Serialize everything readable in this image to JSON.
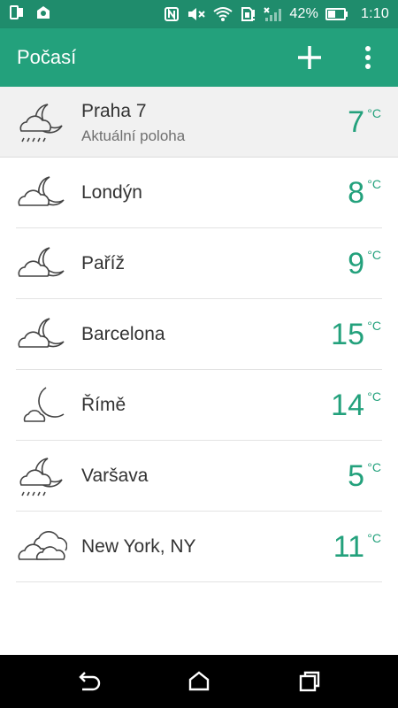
{
  "status_bar": {
    "battery": "42%",
    "time": "1:10"
  },
  "app_bar": {
    "title": "Počasí",
    "add_icon": "plus-icon",
    "menu_icon": "more-vertical-icon"
  },
  "colors": {
    "primary": "#23a17c",
    "status_bar": "#1f8c6c",
    "current_row_bg": "#f1f1f1"
  },
  "locations": [
    {
      "city": "Praha 7",
      "subtitle": "Aktuální poloha",
      "temp": "7",
      "unit": "°C",
      "icon": "night-cloud-rain-icon"
    },
    {
      "city": "Londýn",
      "temp": "8",
      "unit": "°C",
      "icon": "night-cloud-icon"
    },
    {
      "city": "Paříž",
      "temp": "9",
      "unit": "°C",
      "icon": "night-cloud-icon"
    },
    {
      "city": "Barcelona",
      "temp": "15",
      "unit": "°C",
      "icon": "night-cloud-icon"
    },
    {
      "city": "Římě",
      "temp": "14",
      "unit": "°C",
      "icon": "night-partly-cloudy-icon"
    },
    {
      "city": "Varšava",
      "temp": "5",
      "unit": "°C",
      "icon": "night-cloud-rain-icon"
    },
    {
      "city": "New York, NY",
      "temp": "11",
      "unit": "°C",
      "icon": "cloudy-icon"
    }
  ],
  "nav_bar": {
    "back_icon": "back-icon",
    "home_icon": "home-icon",
    "recents_icon": "recents-icon"
  }
}
